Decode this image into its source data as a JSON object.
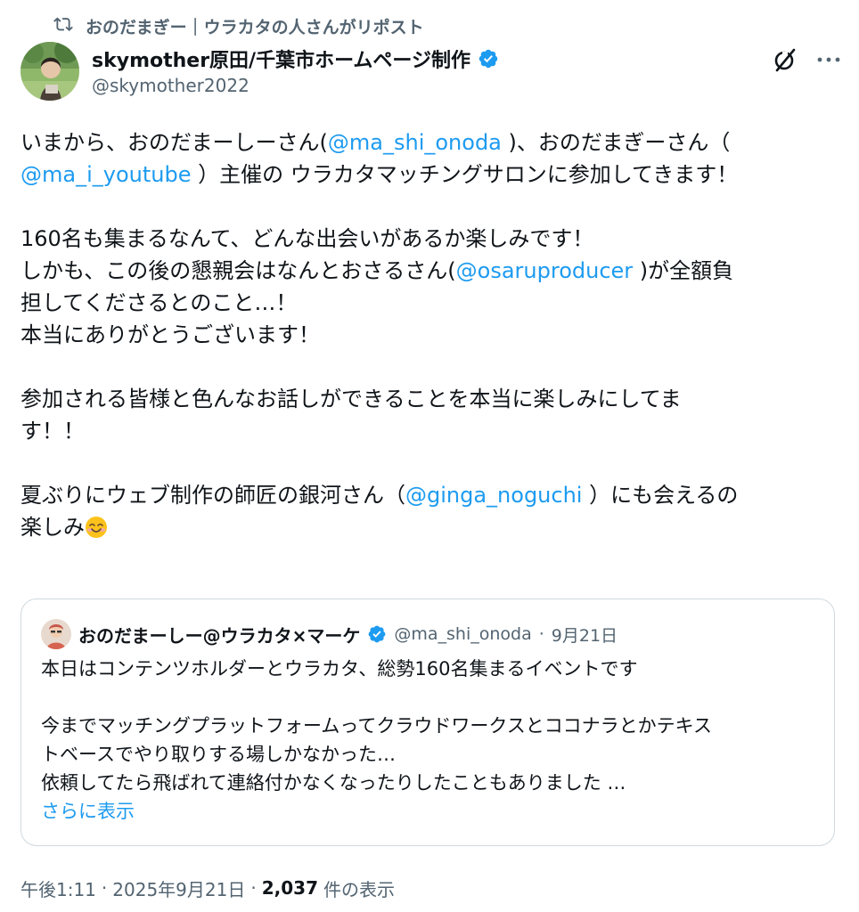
{
  "repost": {
    "icon": "repost-icon",
    "text": "おのだまぎー｜ウラカタの人さんがリポスト"
  },
  "author": {
    "name": "skymother原田/千葉市ホームページ制作",
    "handle": "@skymother2022",
    "verified_icon": "verified-badge-icon"
  },
  "actions": {
    "grok_icon": "grok-icon",
    "more_icon": "more-icon"
  },
  "tweet": {
    "line1_a": "いまから、おのだまーしーさん(",
    "line1_mention": "@ma_shi_onoda",
    "line1_b": " )、おのだまぎーさん（",
    "line2_mention": "@ma_i_youtube",
    "line2_b": " ）主催の ウラカタマッチングサロンに参加してきます！",
    "line3": "160名も集まるなんて、どんな出会いがあるか楽しみです！",
    "line4_a": "しかも、この後の懇親会はなんとおさるさん(",
    "line4_mention": "@osaruproducer",
    "line4_b": " )が全額負",
    "line5": "担してくださるとのこと…！",
    "line6": "本当にありがとうございます！",
    "line7": "参加される皆様と色んなお話しができることを本当に楽しみにしてま",
    "line8": "す！！",
    "line9_a": "夏ぶりにウェブ制作の師匠の銀河さん（",
    "line9_mention": "@ginga_noguchi",
    "line9_b": " ）にも会えるの",
    "line10": "楽しみ",
    "emoji": "smiling-face-emoji"
  },
  "quote": {
    "name": "おのだまーしー@ウラカタ×マーケ",
    "handle": "@ma_shi_onoda",
    "dot": "·",
    "date": "9月21日",
    "line1": "本日はコンテンツホルダーとウラカタ、総勢160名集まるイベントです",
    "line2": "今までマッチングプラットフォームってクラウドワークスとココナラとかテキス",
    "line3": "トベースでやり取りする場しかなかった…",
    "line4": "依頼してたら飛ばれて連絡付かなくなったりしたこともありました …",
    "show_more": "さらに表示"
  },
  "meta": {
    "time": "午後1:11",
    "sep1": "·",
    "date": "2025年9月21日",
    "sep2": "·",
    "views_count": "2,037",
    "views_label": "件の表示"
  },
  "colors": {
    "accent": "#1d9bf0",
    "text": "#0f1419",
    "secondary": "#536471",
    "border": "#cfd9de"
  }
}
